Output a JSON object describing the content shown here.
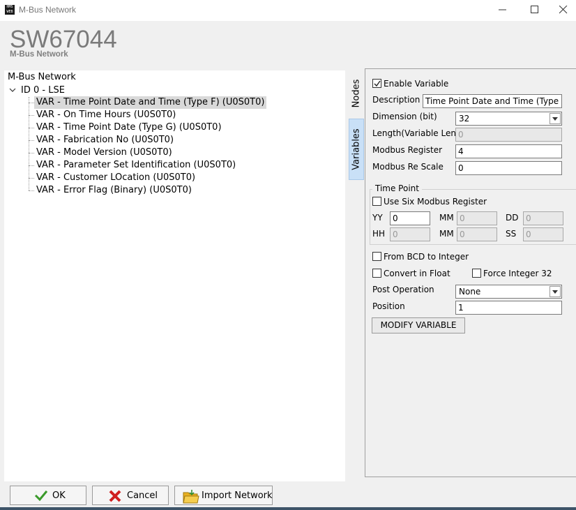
{
  "window": {
    "title": "M-Bus Network",
    "icon": "app-logo-icon",
    "icon_text": "HMS WEB"
  },
  "header": {
    "app_name": "SW67044",
    "subtitle": "M-Bus Network"
  },
  "tree": {
    "root": "M-Bus Network",
    "node": "ID 0 - LSE",
    "items": [
      "VAR - Time Point Date and Time (Type F) (U0S0T0)",
      "VAR - On Time Hours (U0S0T0)",
      "VAR - Time Point Date (Type G) (U0S0T0)",
      "VAR - Fabrication No (U0S0T0)",
      "VAR - Model Version (U0S0T0)",
      "VAR - Parameter Set Identification (U0S0T0)",
      "VAR - Customer LOcation (U0S0T0)",
      "VAR - Error Flag (Binary) (U0S0T0)"
    ],
    "selected_index": 0
  },
  "tabs": {
    "nodes": "Nodes",
    "variables": "Variables",
    "active": "Variables"
  },
  "variable": {
    "enable_label": "Enable Variable",
    "enable_checked": true,
    "description_label": "Description",
    "description_value": "Time Point Date and Time (Type F)",
    "dimension_label": "Dimension (bit)",
    "dimension_value": "32",
    "length_label": "Length(Variable Len)",
    "length_value": "0",
    "modbus_register_label": "Modbus Register",
    "modbus_register_value": "4",
    "modbus_scale_label": "Modbus Re Scale",
    "modbus_scale_value": "0",
    "time_point": {
      "title": "Time Point",
      "use_six_label": "Use Six Modbus Register",
      "use_six_checked": false,
      "yy_label": "YY",
      "yy_value": "0",
      "mm1_label": "MM",
      "mm1_value": "0",
      "dd_label": "DD",
      "dd_value": "0",
      "hh_label": "HH",
      "hh_value": "0",
      "mm2_label": "MM",
      "mm2_value": "0",
      "ss_label": "SS",
      "ss_value": "0"
    },
    "bcd_label": "From BCD to Integer",
    "bcd_checked": false,
    "float_label": "Convert in Float",
    "float_checked": false,
    "force_int_label": "Force Integer 32",
    "force_int_checked": false,
    "post_operation_label": "Post Operation",
    "post_operation_value": "None",
    "position_label": "Position",
    "position_value": "1",
    "modify_button": "MODIFY VARIABLE"
  },
  "buttons": {
    "ok": "OK",
    "cancel": "Cancel",
    "import": "Import Network"
  },
  "colors": {
    "selected_tab": "#c9e0f7",
    "ok_check": "#3a9a2a",
    "cancel_x": "#d02020",
    "folder": "#e8b020"
  }
}
